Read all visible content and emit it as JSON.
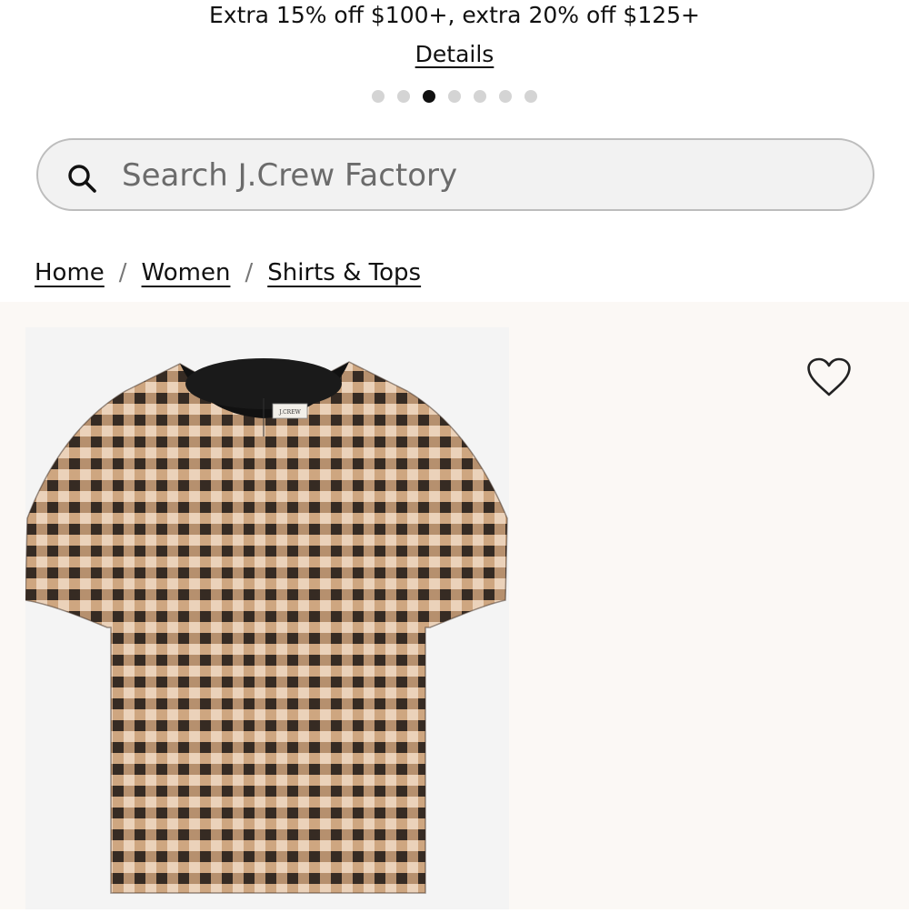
{
  "promo": {
    "text": "Extra 15% off $100+, extra 20% off $125+",
    "link": "Details",
    "slides_total": 7,
    "active_slide_index": 2
  },
  "search": {
    "placeholder": "Search J.Crew Factory",
    "value": "",
    "icon": "search-icon"
  },
  "breadcrumb": {
    "items": [
      "Home",
      "Women",
      "Shirts & Tops"
    ],
    "separator": "/"
  },
  "product": {
    "image_alt": "Metallic gingham short-sleeve top",
    "label_text": "J.CREW",
    "favorite_icon": "heart-outline-icon"
  },
  "colors": {
    "accent": "#111111",
    "product_bg": "#fbf8f5",
    "search_bg": "#f2f2f2",
    "gingham_dark": "#1c1410",
    "gingham_gold": "#c9a07a",
    "gingham_light": "#ead2bc"
  }
}
